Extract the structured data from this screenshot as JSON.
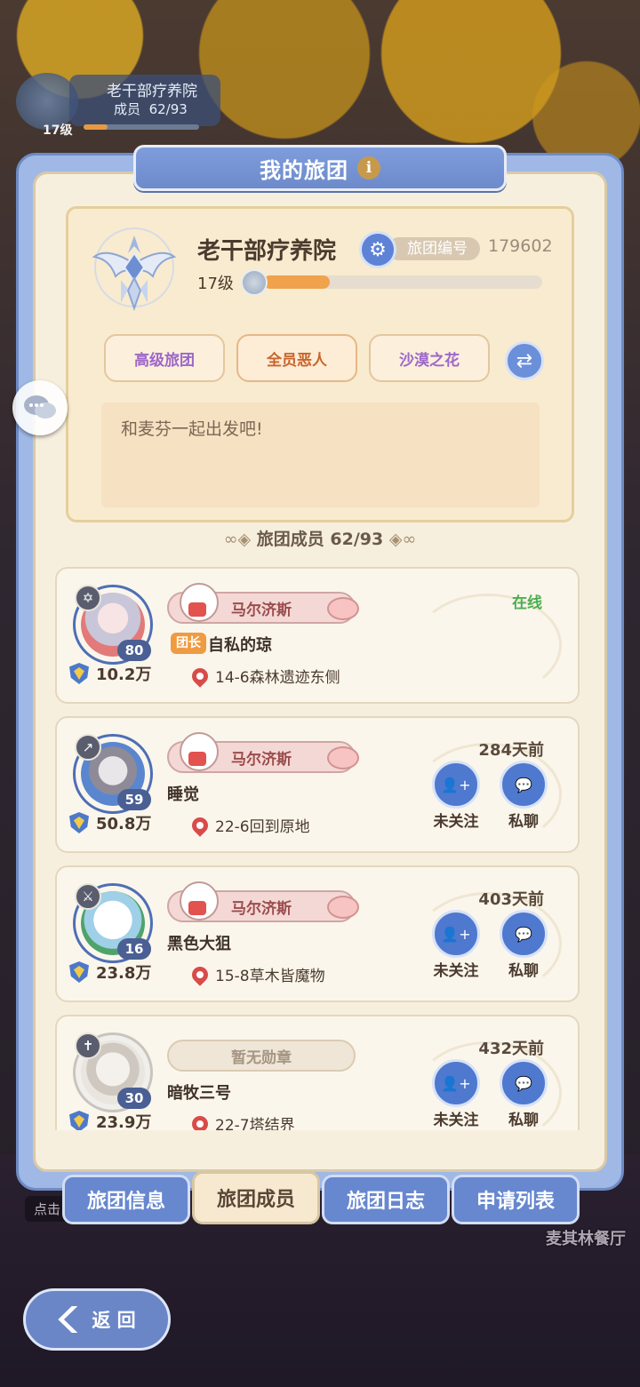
{
  "background": {
    "top_guild": {
      "name": "老干部疗养院",
      "members_label": "成员",
      "members_count": "62/93",
      "level": "17级",
      "xp_fraction": 0.21
    },
    "hint": "点击",
    "restaurant": "麦其林餐厅"
  },
  "panel": {
    "title": "我的旅团",
    "info_icon": "i"
  },
  "guild": {
    "name": "老干部疗养院",
    "id_label": "旅团编号",
    "id": "179602",
    "level": "17级",
    "xp_fraction": 0.24,
    "tags": [
      "高级旅团",
      "全员恶人",
      "沙漠之花"
    ],
    "motto": "和麦芬一起出发吧!"
  },
  "members_heading": "旅团成员 62/93",
  "members": [
    {
      "level": "80",
      "power": "10.2万",
      "medal": "马尔济斯",
      "role": "团长",
      "name": "自私的琼",
      "location": "14-6森林遗迹东侧",
      "status": "在线",
      "online": true,
      "class_icon": "✡"
    },
    {
      "level": "59",
      "power": "50.8万",
      "medal": "马尔济斯",
      "role": "",
      "name": "睡觉",
      "location": "22-6回到原地",
      "status": "284天前",
      "online": false,
      "class_icon": "↗",
      "follow": "未关注",
      "chat": "私聊"
    },
    {
      "level": "16",
      "power": "23.8万",
      "medal": "马尔济斯",
      "role": "",
      "name": "黑色大狙",
      "location": "15-8草木皆魔物",
      "status": "403天前",
      "online": false,
      "class_icon": "⚔",
      "follow": "未关注",
      "chat": "私聊"
    },
    {
      "level": "30",
      "power": "23.9万",
      "medal": "暂无勋章",
      "role": "",
      "name": "暗牧三号",
      "location": "22-7塔结界",
      "status": "432天前",
      "online": false,
      "class_icon": "✝",
      "follow": "未关注",
      "chat": "私聊"
    }
  ],
  "tabs": [
    "旅团信息",
    "旅团成员",
    "旅团日志",
    "申请列表"
  ],
  "active_tab": "旅团成员",
  "back_label": "返 回"
}
